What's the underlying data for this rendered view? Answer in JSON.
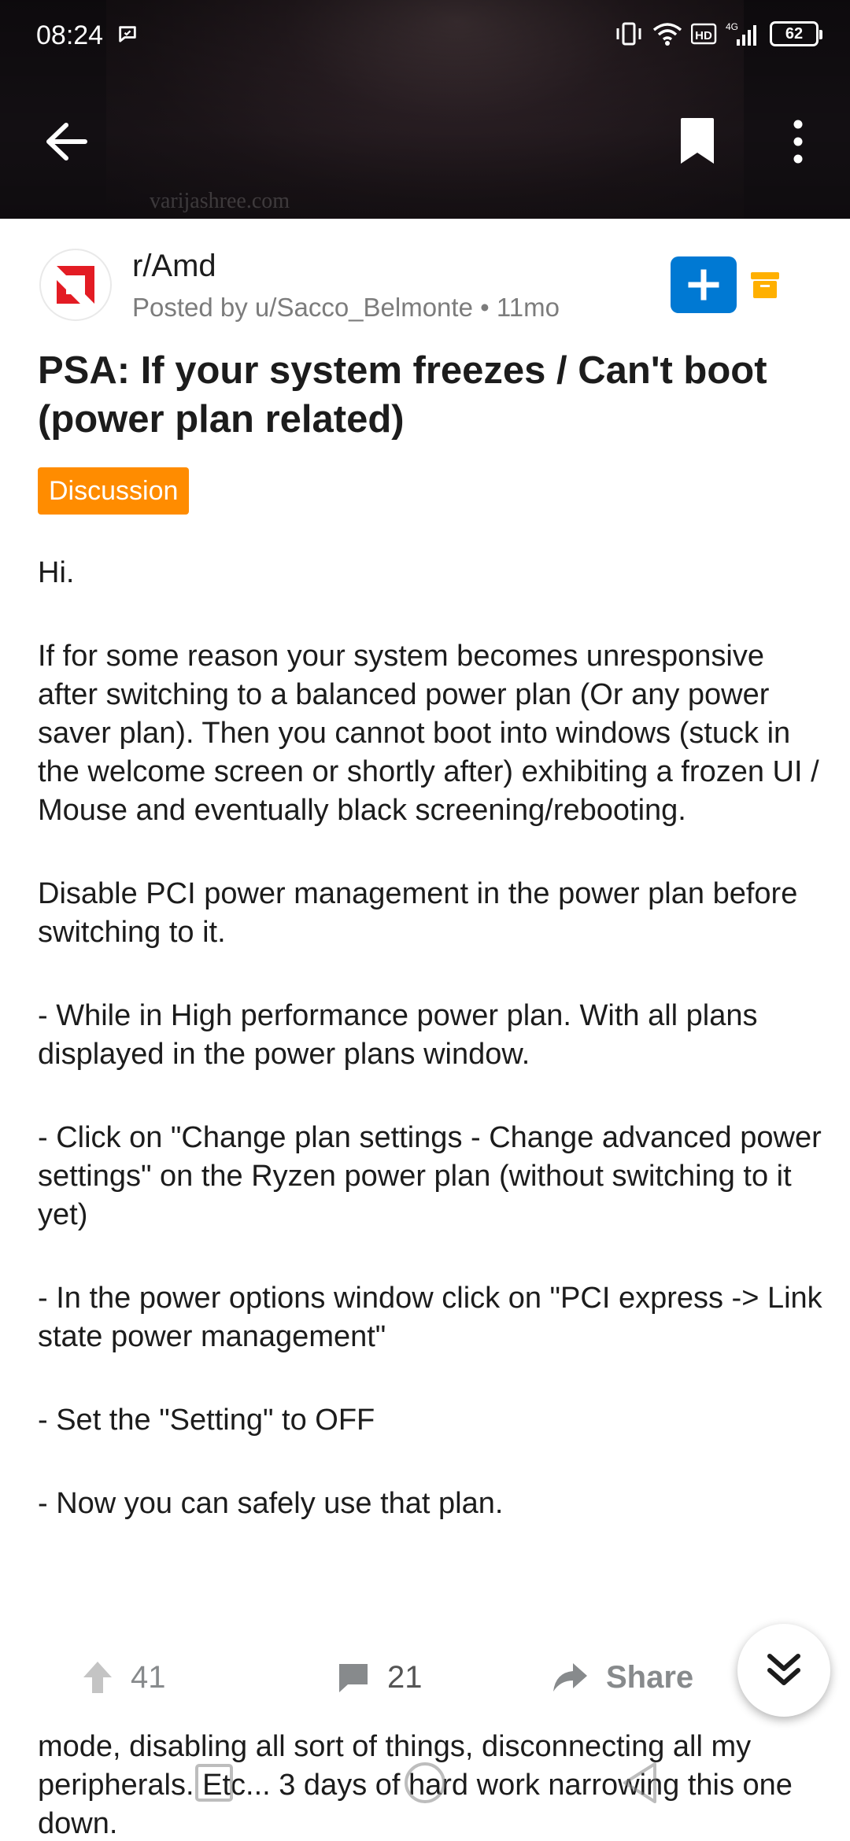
{
  "status_bar": {
    "time": "08:24",
    "battery": "62",
    "network": "4G"
  },
  "header": {
    "watermark": "varijashree.com"
  },
  "post": {
    "subreddit": "r/Amd",
    "meta": "Posted by u/Sacco_Belmonte • 11mo",
    "title": "PSA: If your system freezes / Can't boot (power plan related)",
    "flair": "Discussion",
    "body": [
      "Hi.",
      "If for some reason your system becomes unresponsive after switching to a balanced power plan (Or any power saver plan). Then you cannot boot into windows (stuck in the welcome screen or shortly after) exhibiting a frozen UI / Mouse and eventually black screening/rebooting.",
      "Disable PCI power management in the power plan before switching to it.",
      "- While in High performance power plan. With all plans displayed in the power plans window.",
      "- Click on \"Change plan settings - Change advanced power settings\" on the Ryzen power plan (without switching to it yet)",
      "- In the power options window click on \"PCI express -> Link state power management\"",
      "- Set the \"Setting\" to OFF",
      "- Now you can safely use that plan."
    ]
  },
  "actions": {
    "upvotes": "41",
    "comments": "21",
    "share_label": "Share"
  },
  "comment_preview": {
    "text": "mode, disabling all sort of things, disconnecting all my peripherals. Etc... 3 days of hard work narrowing this one down."
  },
  "colors": {
    "accent_blue": "#0079d3",
    "flair_orange": "#ff8c00",
    "archive_yellow": "#ffb000",
    "amd_red": "#e31c24"
  }
}
